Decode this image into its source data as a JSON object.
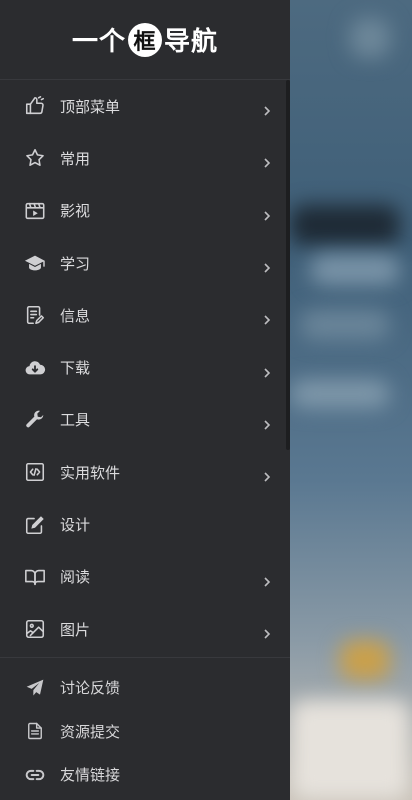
{
  "logo": {
    "before": "一个",
    "circled": "框",
    "after": "导航"
  },
  "menu": [
    {
      "label": "顶部菜单",
      "icon": "thumbs-up-icon",
      "chevron": true
    },
    {
      "label": "常用",
      "icon": "star-icon",
      "chevron": true
    },
    {
      "label": "影视",
      "icon": "film-icon",
      "chevron": true
    },
    {
      "label": "学习",
      "icon": "graduation-cap-icon",
      "chevron": true
    },
    {
      "label": "信息",
      "icon": "document-edit-icon",
      "chevron": true
    },
    {
      "label": "下载",
      "icon": "cloud-download-icon",
      "chevron": true
    },
    {
      "label": "工具",
      "icon": "wrench-icon",
      "chevron": true
    },
    {
      "label": "实用软件",
      "icon": "code-icon",
      "chevron": true
    },
    {
      "label": "设计",
      "icon": "pen-square-icon",
      "chevron": false
    },
    {
      "label": "阅读",
      "icon": "book-open-icon",
      "chevron": true
    },
    {
      "label": "图片",
      "icon": "image-icon",
      "chevron": true
    }
  ],
  "footer": [
    {
      "label": "讨论反馈",
      "icon": "paper-plane-icon"
    },
    {
      "label": "资源提交",
      "icon": "document-lines-icon"
    },
    {
      "label": "友情链接",
      "icon": "link-icon"
    }
  ]
}
